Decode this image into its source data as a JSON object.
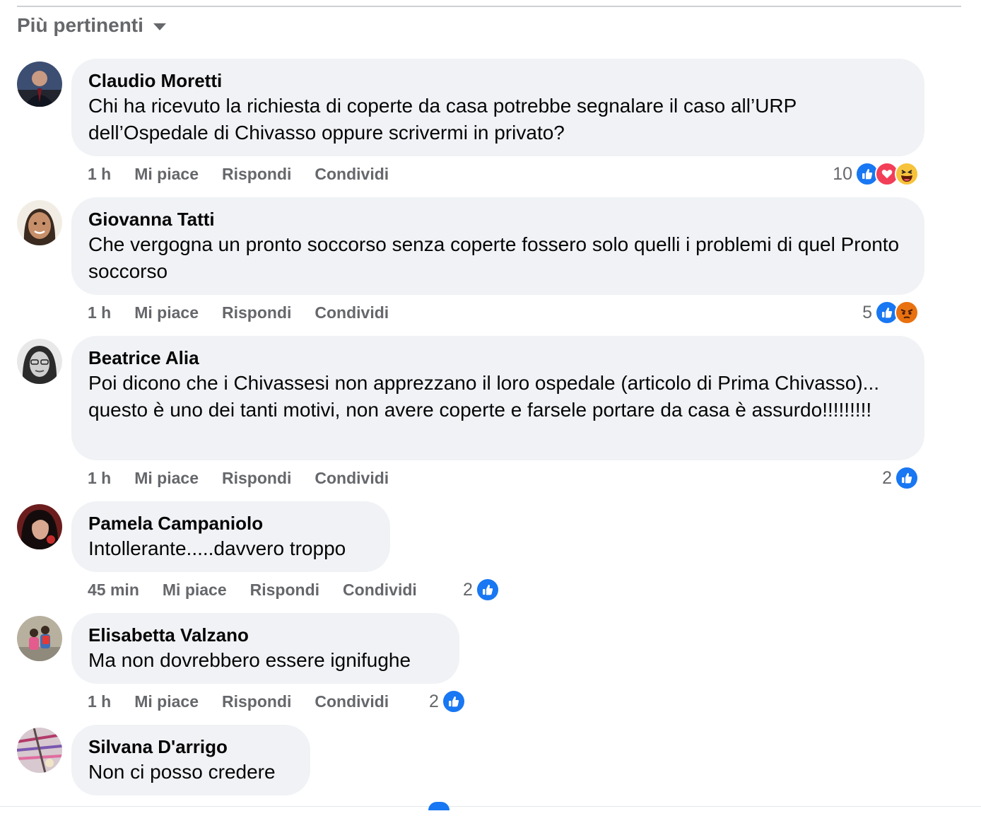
{
  "sort": {
    "label": "Più pertinenti"
  },
  "actions": {
    "like": "Mi piace",
    "reply": "Rispondi",
    "share": "Condividi"
  },
  "comments": [
    {
      "author": "Claudio Moretti",
      "text": "Chi ha ricevuto la richiesta di coperte da casa potrebbe segnalare il caso all’URP dell’Ospedale di Chivasso oppure scrivermi in privato?",
      "time": "1 h",
      "reaction_count": "10",
      "reactions": [
        "like",
        "love",
        "haha"
      ]
    },
    {
      "author": "Giovanna Tatti",
      "text": "Che vergogna un pronto soccorso senza coperte fossero solo quelli i problemi di quel Pronto soccorso",
      "time": "1 h",
      "reaction_count": "5",
      "reactions": [
        "like",
        "angry"
      ]
    },
    {
      "author": "Beatrice Alia",
      "text": "Poi dicono che i Chivassesi non apprezzano il loro ospedale (articolo di Prima Chivasso)... questo è uno dei tanti motivi, non avere coperte e farsele portare da casa è assurdo!!!!!!!!!",
      "time": "1 h",
      "reaction_count": "2",
      "reactions": [
        "like"
      ]
    },
    {
      "author": "Pamela Campaniolo",
      "text": "Intollerante.....davvero troppo",
      "time": "45 min",
      "reaction_count": "2",
      "reactions": [
        "like"
      ]
    },
    {
      "author": "Elisabetta Valzano",
      "text": "Ma non dovrebbero essere ignifughe",
      "time": "1 h",
      "reaction_count": "2",
      "reactions": [
        "like"
      ]
    },
    {
      "author": "Silvana D'arrigo",
      "text": "Non ci posso credere"
    }
  ],
  "colors": {
    "bubble": "#f0f2f5",
    "secondary_text": "#65676b",
    "like_blue": "#1877f2",
    "love_red": "#f33e58",
    "haha_yellow": "#f7c33b",
    "angry_orange": "#e9710f"
  }
}
